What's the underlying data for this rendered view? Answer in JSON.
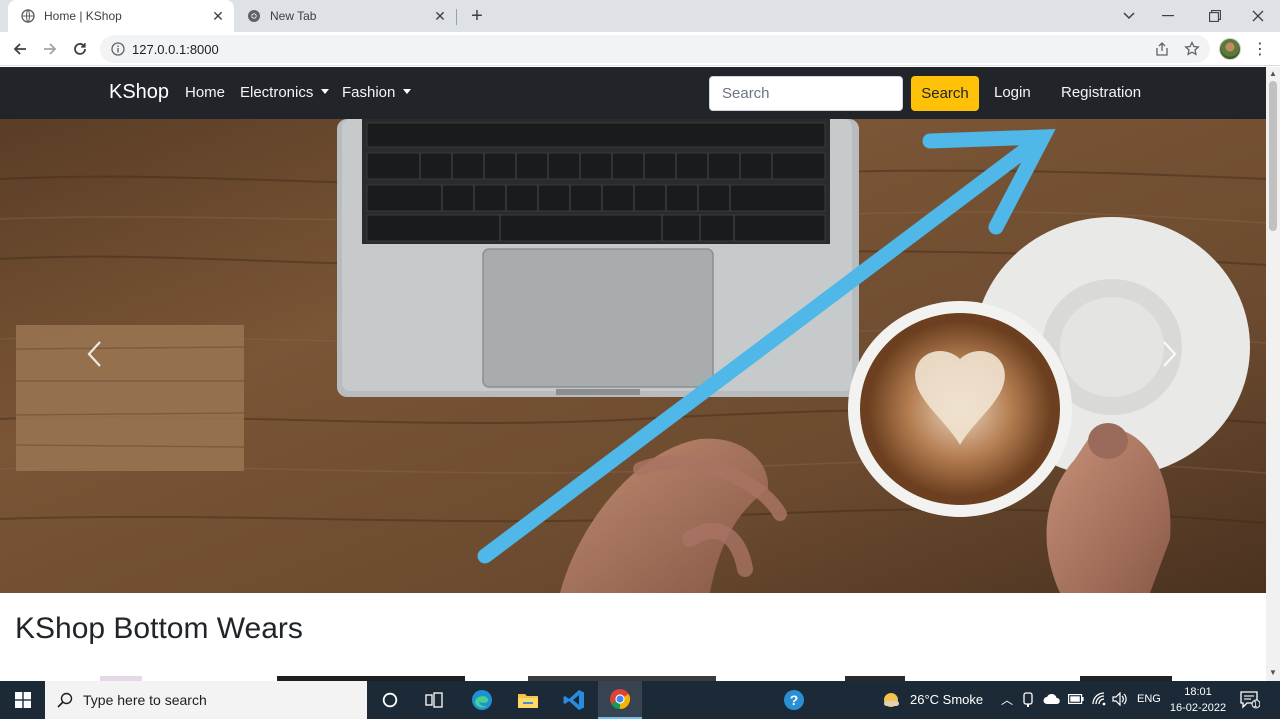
{
  "browser": {
    "tabs": [
      {
        "title": "Home | KShop",
        "active": true
      },
      {
        "title": "New Tab",
        "active": false
      }
    ],
    "url": "127.0.0.1:8000"
  },
  "site": {
    "brand": "KShop",
    "nav": {
      "home": "Home",
      "electronics": "Electronics",
      "fashion": "Fashion",
      "login": "Login",
      "registration": "Registration"
    },
    "search": {
      "placeholder": "Search",
      "button": "Search"
    },
    "section_title": "KShop Bottom Wears"
  },
  "taskbar": {
    "search_placeholder": "Type here to search",
    "weather": "26°C  Smoke",
    "language": "ENG",
    "time": "18:01",
    "date": "16-02-2022",
    "notification_count": "1"
  },
  "colors": {
    "navbar": "#212529",
    "search_button": "#ffc107",
    "annotation_arrow": "#4fb8e8",
    "taskbar": "#1c2a38"
  }
}
